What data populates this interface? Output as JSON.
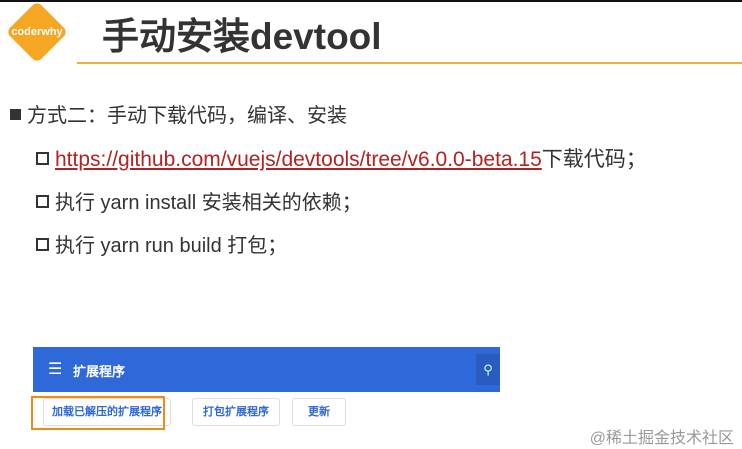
{
  "logo": "coderwhy",
  "title": "手动安装devtool",
  "bullet": "方式二：手动下载代码，编译、安装",
  "items": {
    "link": "https://github.com/vuejs/devtools/tree/v6.0.0-beta.15",
    "link_suffix": "下载代码；",
    "i2": "执行 yarn install 安装相关的依赖；",
    "i3": "执行 yarn run build 打包；"
  },
  "ext": {
    "title": "扩展程序",
    "b1": "加载已解压的扩展程序",
    "b2": "打包扩展程序",
    "b3": "更新"
  },
  "watermark": "@稀土掘金技术社区"
}
